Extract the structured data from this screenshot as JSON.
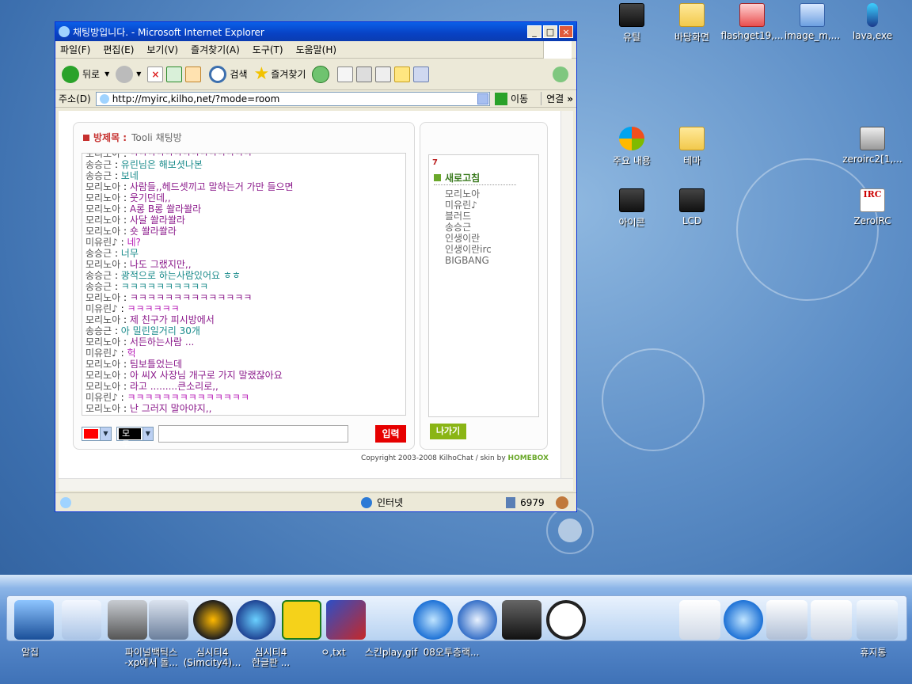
{
  "desktop_icons": [
    {
      "label": "유틸",
      "icon": "dark-folder-icon"
    },
    {
      "label": "바탕화면",
      "icon": "folder-icon"
    },
    {
      "label": "flashget19,...",
      "icon": "installer-icon"
    },
    {
      "label": "image_m,...",
      "icon": "image-icon"
    },
    {
      "label": "lava,exe",
      "icon": "lava-lamp-icon"
    },
    {
      "label": "주요 내용",
      "icon": "windows-icon"
    },
    {
      "label": "테마",
      "icon": "folder-icon"
    },
    {
      "label": "zeroirc2[1,...",
      "icon": "installer-icon"
    },
    {
      "label": "아이콘",
      "icon": "dark-folder-icon"
    },
    {
      "label": "LCD",
      "icon": "dark-folder-icon"
    },
    {
      "label": "ZeroIRC",
      "icon": "zero-irc-icon"
    }
  ],
  "window": {
    "title": "채팅방입니다. - Microsoft Internet Explorer",
    "menu": [
      "파일(F)",
      "편집(E)",
      "보기(V)",
      "즐겨찾기(A)",
      "도구(T)",
      "도움말(H)"
    ],
    "toolbar": {
      "back": "뒤로",
      "search": "검색",
      "favorites": "즐겨찾기"
    },
    "address": {
      "label": "주소(D)",
      "url": "http://myirc,kilho,net/?mode=room",
      "go": "이동",
      "links": "연결"
    },
    "status": {
      "zone": "인터넷",
      "count": "6979"
    }
  },
  "chat": {
    "room_label": "방제목 :",
    "room_name": "Tooli 채팅방",
    "messages": [
      {
        "nick": "모리노아",
        "text": "ㅋㅋㅋㅋㅋㅋㅋㅋㅋㅋㅋㅋㅋㅋ",
        "color": "#8b1a8b"
      },
      {
        "nick": "송승근",
        "text": "유린님은 해보셧나본",
        "color": "#1a8b8b"
      },
      {
        "nick": "송승근",
        "text": "보네",
        "color": "#1a8b8b"
      },
      {
        "nick": "모리노아",
        "text": "사람들,,헤드셋끼고 말하는거 가만 들으면",
        "color": "#8b1a8b"
      },
      {
        "nick": "모리노아",
        "text": "웃기던데,,",
        "color": "#8b1a8b"
      },
      {
        "nick": "모리노아",
        "text": "A롱 B롱 쏼라쏼라",
        "color": "#8b1a8b"
      },
      {
        "nick": "모리노아",
        "text": "사달 쏼라쏼라",
        "color": "#8b1a8b"
      },
      {
        "nick": "모리노아",
        "text": "숏 쏼라쏼라",
        "color": "#8b1a8b"
      },
      {
        "nick": "미유린♪",
        "text": "네?",
        "color": "#b71cb7"
      },
      {
        "nick": "송승근",
        "text": "너무",
        "color": "#1a8b8b"
      },
      {
        "nick": "모리노아",
        "text": "나도 그랬지만,,",
        "color": "#8b1a8b"
      },
      {
        "nick": "송승근",
        "text": "광적으로 하는사람있어요 ㅎㅎ",
        "color": "#1a8b8b"
      },
      {
        "nick": "송승근",
        "text": "ㅋㅋㅋㅋㅋㅋㅋㅋㅋㅋ",
        "color": "#1a8b8b"
      },
      {
        "nick": "모리노아",
        "text": "ㅋㅋㅋㅋㅋㅋㅋㅋㅋㅋㅋㅋㅋㅋ",
        "color": "#8b1a8b"
      },
      {
        "nick": "미유린♪",
        "text": "ㅋㅋㅋㅋㅋㅋ",
        "color": "#b71cb7"
      },
      {
        "nick": "모리노아",
        "text": "제 친구가 피시방에서",
        "color": "#8b1a8b"
      },
      {
        "nick": "송승근",
        "text": "아 밀린일거리 30개",
        "color": "#1a8b8b"
      },
      {
        "nick": "모리노아",
        "text": "서든하는사람 ...",
        "color": "#8b1a8b"
      },
      {
        "nick": "미유린♪",
        "text": "헉",
        "color": "#b71cb7"
      },
      {
        "nick": "모리노아",
        "text": "팀보틀었는데",
        "color": "#8b1a8b"
      },
      {
        "nick": "모리노아",
        "text": "아 씨X 사장님 개구로 가지 말랬잖아요",
        "color": "#8b1a8b"
      },
      {
        "nick": "모리노아",
        "text": "라고 .........큰소리로,,",
        "color": "#8b1a8b"
      },
      {
        "nick": "미유린♪",
        "text": "ㅋㅋㅋㅋㅋㅋㅋㅋㅋㅋㅋㅋㅋㅋ",
        "color": "#b71cb7"
      },
      {
        "nick": "모리노아",
        "text": "난 그러지 말아야지,,",
        "color": "#8b1a8b"
      }
    ],
    "user_count": "7",
    "refresh_label": "새로고침",
    "users": [
      "모리노아",
      "미유린♪",
      "블러드",
      "송승근",
      "인생이란",
      "인생이란irc",
      "BIGBANG"
    ],
    "exit_label": "나가기",
    "target_label": "모두",
    "send_label": "입력",
    "copyright": "Copyright 2003-2008 KilhoChat / skin by ",
    "skin_brand": "HOMEBOX"
  },
  "dock": {
    "labels": [
      {
        "text": "알집"
      },
      {
        "text": "파이널백틱스\n-xp에서 돌..."
      },
      {
        "text": "심시티4\n(Simcity4)..."
      },
      {
        "text": "심시티4\n한글판 ..."
      },
      {
        "text": "ㅇ,txt"
      },
      {
        "text": "스킨play,gif"
      },
      {
        "text": "08오투층랙..."
      },
      {
        "text": "휴지통"
      }
    ]
  },
  "colors": {
    "title_blue": "#0842c4",
    "send_red": "#e60000",
    "exit_green": "#8ab515"
  }
}
